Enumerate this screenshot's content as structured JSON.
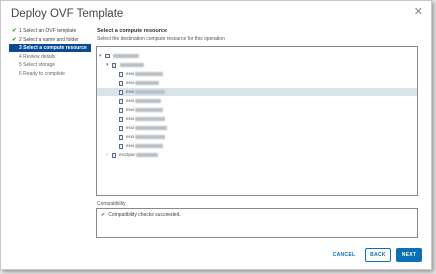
{
  "dialog": {
    "title": "Deploy OVF Template",
    "close_icon": "close-icon"
  },
  "steps": [
    {
      "label": "1 Select an OVF template",
      "state": "done",
      "mark": "✔"
    },
    {
      "label": "2 Select a name and folder",
      "state": "done",
      "mark": "✔"
    },
    {
      "label": "3 Select a compute resource",
      "state": "active",
      "mark": ""
    },
    {
      "label": "4 Review details",
      "state": "pending",
      "mark": ""
    },
    {
      "label": "5 Select storage",
      "state": "pending",
      "mark": ""
    },
    {
      "label": "6 Ready to complete",
      "state": "pending",
      "mark": ""
    }
  ],
  "main": {
    "title": "Select a compute resource",
    "description": "Select the destination compute resource for this operation"
  },
  "tree": {
    "rows": [
      {
        "label": "",
        "level": 0,
        "icon": "datacenter-icon",
        "toggle": "▾",
        "selected": false
      },
      {
        "label": "",
        "level": 1,
        "icon": "cluster-icon",
        "toggle": "▾",
        "selected": false
      },
      {
        "label": "esxi",
        "level": 2,
        "icon": "host-icon",
        "toggle": "",
        "selected": false
      },
      {
        "label": "esxi",
        "level": 2,
        "icon": "host-icon",
        "toggle": "",
        "selected": false
      },
      {
        "label": "esxi",
        "level": 2,
        "icon": "host-icon",
        "toggle": "",
        "selected": true
      },
      {
        "label": "esxi",
        "level": 2,
        "icon": "host-icon",
        "toggle": "",
        "selected": false
      },
      {
        "label": "esxi",
        "level": 2,
        "icon": "host-icon",
        "toggle": "",
        "selected": false
      },
      {
        "label": "esxi",
        "level": 2,
        "icon": "host-icon",
        "toggle": "",
        "selected": false
      },
      {
        "label": "esxi",
        "level": 2,
        "icon": "host-icon",
        "toggle": "",
        "selected": false
      },
      {
        "label": "esxi",
        "level": 2,
        "icon": "host-icon",
        "toggle": "",
        "selected": false
      },
      {
        "label": "esxi",
        "level": 2,
        "icon": "host-icon",
        "toggle": "",
        "selected": false
      },
      {
        "label": "esx3par",
        "level": 1,
        "icon": "host-icon",
        "toggle": "›",
        "selected": false
      }
    ]
  },
  "compatibility": {
    "label": "Compatibility",
    "message": "Compatibility checks succeeded.",
    "status_icon": "check-icon",
    "status_mark": "✔"
  },
  "footer": {
    "cancel": "CANCEL",
    "back": "BACK",
    "next": "NEXT"
  },
  "colors": {
    "accent": "#0a6fb5",
    "active_step": "#0a4c92",
    "success": "#3b9a2a",
    "selected_row": "#d9e4ea"
  }
}
